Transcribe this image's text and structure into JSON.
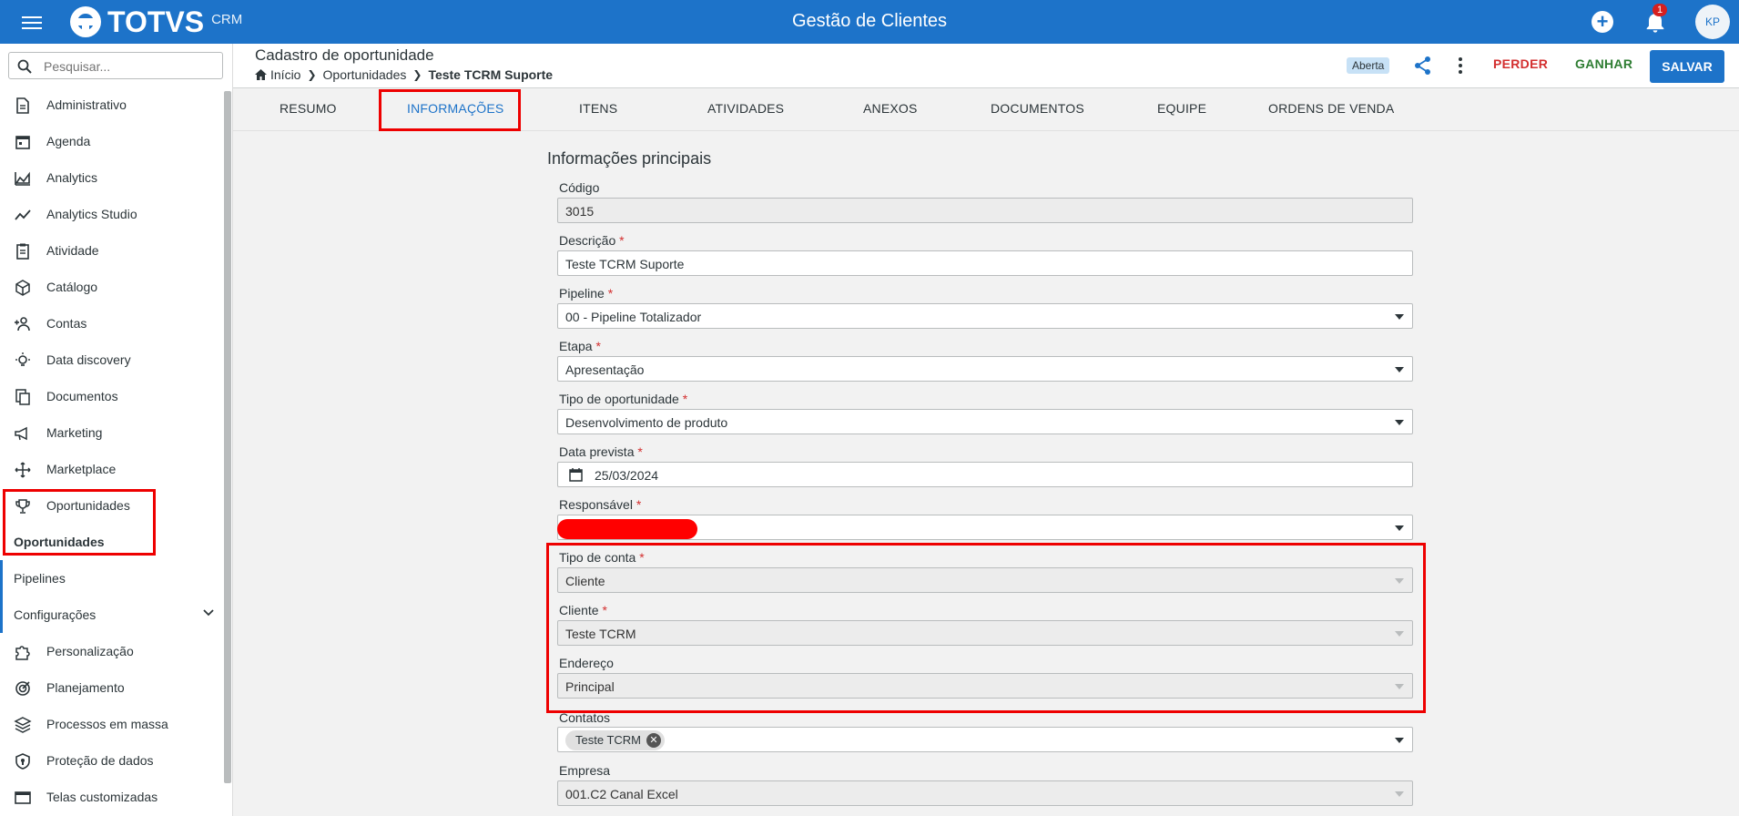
{
  "topbar": {
    "brand": "TOTVS",
    "brand_sub": "CRM",
    "title": "Gestão de Clientes",
    "notifications": "1",
    "avatar": "KP"
  },
  "sidebar": {
    "search_placeholder": "Pesquisar...",
    "items": [
      {
        "label": "Administrativo",
        "icon": "document-icon"
      },
      {
        "label": "Agenda",
        "icon": "calendar-icon"
      },
      {
        "label": "Analytics",
        "icon": "area-chart-icon"
      },
      {
        "label": "Analytics Studio",
        "icon": "line-chart-icon"
      },
      {
        "label": "Atividade",
        "icon": "clipboard-icon"
      },
      {
        "label": "Catálogo",
        "icon": "box-icon"
      },
      {
        "label": "Contas",
        "icon": "people-icon"
      },
      {
        "label": "Data discovery",
        "icon": "lightbulb-icon"
      },
      {
        "label": "Documentos",
        "icon": "documents-icon"
      },
      {
        "label": "Marketing",
        "icon": "megaphone-icon"
      },
      {
        "label": "Marketplace",
        "icon": "arrows-icon"
      },
      {
        "label": "Oportunidades",
        "icon": "trophy-icon"
      }
    ],
    "sub_items": [
      {
        "label": "Oportunidades"
      },
      {
        "label": "Pipelines"
      },
      {
        "label": "Configurações"
      }
    ],
    "items_after": [
      {
        "label": "Personalização",
        "icon": "puzzle-icon"
      },
      {
        "label": "Planejamento",
        "icon": "target-icon"
      },
      {
        "label": "Processos em massa",
        "icon": "layers-icon"
      },
      {
        "label": "Proteção de dados",
        "icon": "shield-icon"
      },
      {
        "label": "Telas customizadas",
        "icon": "window-icon"
      }
    ]
  },
  "header": {
    "title": "Cadastro de oportunidade",
    "breadcrumb": [
      "Início",
      "Oportunidades",
      "Teste TCRM Suporte"
    ],
    "status": "Aberta",
    "perder": "PERDER",
    "ganhar": "GANHAR",
    "salvar": "SALVAR"
  },
  "tabs": [
    "RESUMO",
    "INFORMAÇÕES",
    "ITENS",
    "ATIVIDADES",
    "ANEXOS",
    "DOCUMENTOS",
    "EQUIPE",
    "ORDENS DE VENDA"
  ],
  "form": {
    "section": "Informações principais",
    "codigo": {
      "label": "Código",
      "value": "3015"
    },
    "descricao": {
      "label": "Descrição",
      "value": "Teste TCRM Suporte"
    },
    "pipeline": {
      "label": "Pipeline",
      "value": "00 - Pipeline Totalizador"
    },
    "etapa": {
      "label": "Etapa",
      "value": "Apresentação"
    },
    "tipo_oportunidade": {
      "label": "Tipo de oportunidade",
      "value": "Desenvolvimento de produto"
    },
    "data_prevista": {
      "label": "Data prevista",
      "value": "25/03/2024"
    },
    "responsavel": {
      "label": "Responsável",
      "value": ""
    },
    "tipo_conta": {
      "label": "Tipo de conta",
      "value": "Cliente"
    },
    "cliente": {
      "label": "Cliente",
      "value": "Teste TCRM"
    },
    "endereco": {
      "label": "Endereço",
      "value": "Principal"
    },
    "contatos": {
      "label": "Contatos",
      "chip": "Teste TCRM"
    },
    "empresa": {
      "label": "Empresa",
      "value": "001.C2 Canal Excel"
    }
  },
  "colors": {
    "primary": "#1d73c9",
    "danger": "#d32f2f",
    "success": "#2e7d32",
    "highlight": "#e00000"
  }
}
